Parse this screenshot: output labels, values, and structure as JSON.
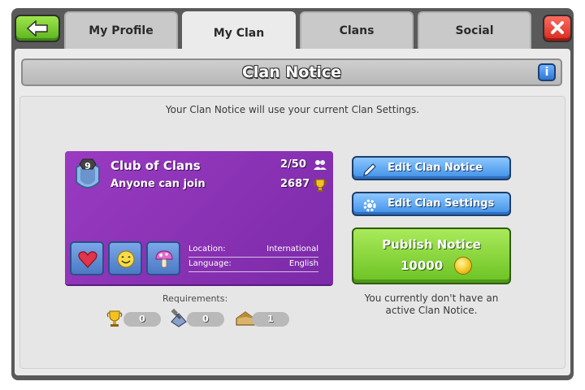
{
  "tabs": [
    {
      "label": "My Profile",
      "active": false
    },
    {
      "label": "My Clan",
      "active": true
    },
    {
      "label": "Clans",
      "active": false
    },
    {
      "label": "Social",
      "active": false
    }
  ],
  "icons": {
    "back": "back-arrow-icon",
    "close": "close-x-icon",
    "info": "info-icon"
  },
  "header": {
    "title": "Clan Notice",
    "info_label": "i"
  },
  "subtitle": "Your Clan Notice will use your current Clan Settings.",
  "clan": {
    "level": "9",
    "name": "Club of Clans",
    "type": "Anyone can join",
    "members": "2/50",
    "trophies": "2687",
    "location_label": "Location:",
    "location": "International",
    "language_label": "Language:",
    "language": "English",
    "labels": [
      "heart-label-icon",
      "smiley-label-icon",
      "mushroom-label-icon"
    ]
  },
  "requirements": {
    "title": "Requirements:",
    "items": [
      {
        "icon": "trophy-icon",
        "value": "0"
      },
      {
        "icon": "builder-hall-icon",
        "value": "0"
      },
      {
        "icon": "town-hall-icon",
        "value": "1"
      }
    ]
  },
  "buttons": {
    "edit_notice": "Edit Clan Notice",
    "edit_settings": "Edit Clan Settings",
    "publish": "Publish Notice",
    "publish_cost": "10000"
  },
  "status": {
    "line1": "You currently don't have an",
    "line2": "active Clan Notice."
  },
  "colors": {
    "card_purple": "#8a33b6",
    "button_blue": "#3f8fe6",
    "button_green": "#6cc223",
    "close_red": "#d62a1f"
  }
}
